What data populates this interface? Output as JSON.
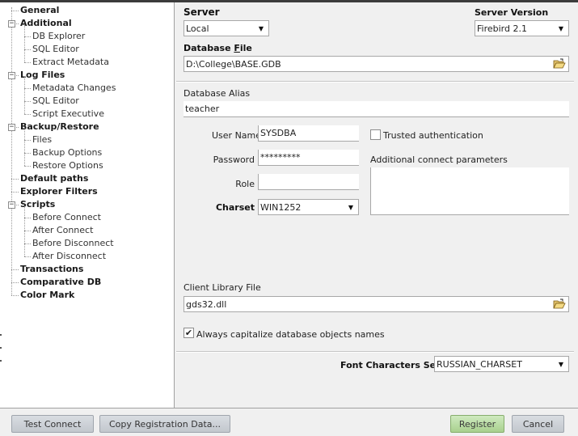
{
  "tree": {
    "items": [
      {
        "label": "General",
        "level": 0
      },
      {
        "label": "Additional",
        "level": 0,
        "expandable": true
      },
      {
        "label": "DB Explorer",
        "level": 1
      },
      {
        "label": "SQL Editor",
        "level": 1
      },
      {
        "label": "Extract Metadata",
        "level": 1
      },
      {
        "label": "Log Files",
        "level": 0,
        "expandable": true
      },
      {
        "label": "Metadata Changes",
        "level": 1
      },
      {
        "label": "SQL Editor",
        "level": 1
      },
      {
        "label": "Script Executive",
        "level": 1
      },
      {
        "label": "Backup/Restore",
        "level": 0,
        "expandable": true
      },
      {
        "label": "Files",
        "level": 1
      },
      {
        "label": "Backup Options",
        "level": 1
      },
      {
        "label": "Restore Options",
        "level": 1
      },
      {
        "label": "Default paths",
        "level": 0
      },
      {
        "label": "Explorer Filters",
        "level": 0
      },
      {
        "label": "Scripts",
        "level": 0,
        "expandable": true
      },
      {
        "label": "Before Connect",
        "level": 1
      },
      {
        "label": "After Connect",
        "level": 1
      },
      {
        "label": "Before Disconnect",
        "level": 1
      },
      {
        "label": "After Disconnect",
        "level": 1
      },
      {
        "label": "Transactions",
        "level": 0
      },
      {
        "label": "Comparative DB",
        "level": 0
      },
      {
        "label": "Color Mark",
        "level": 0
      }
    ]
  },
  "form": {
    "server_label": "Server",
    "server_value": "Local",
    "server_version_label": "Server Version",
    "server_version_value": "Firebird 2.1",
    "database_file_label_prefix": "Database ",
    "database_file_label_accel": "F",
    "database_file_label_suffix": "ile",
    "database_file_value": "D:\\College\\BASE.GDB",
    "database_alias_label": "Database Alias",
    "database_alias_value": "teacher",
    "user_name_label": "User Name",
    "user_name_value": "SYSDBA",
    "password_label": "Password",
    "password_value": "*********",
    "role_label": "Role",
    "role_value": "",
    "charset_label": "Charset",
    "charset_value": "WIN1252",
    "trusted_auth_label": "Trusted authentication",
    "trusted_auth_checked": false,
    "additional_params_label": "Additional connect parameters",
    "client_library_label": "Client Library File",
    "client_library_value": "gds32.dll",
    "capitalize_label": "Always capitalize database objects names",
    "capitalize_checked": true,
    "font_charset_label": "Font Characters Set",
    "font_charset_value": "RUSSIAN_CHARSET"
  },
  "buttons": {
    "test_connect": "Test Connect",
    "copy_registration": "Copy Registration Data...",
    "register": "Register",
    "cancel": "Cancel"
  },
  "colors": {
    "register_button": "#b4d99c",
    "default_button": "#c9cdd2",
    "tree_background": "#ffffff",
    "dialog_background": "#f0f0f0"
  },
  "icons": {
    "browse": "folder-open-icon",
    "dropdown": "chevron-down-icon",
    "expand": "minus-expander-icon",
    "check": "checkmark-icon"
  }
}
